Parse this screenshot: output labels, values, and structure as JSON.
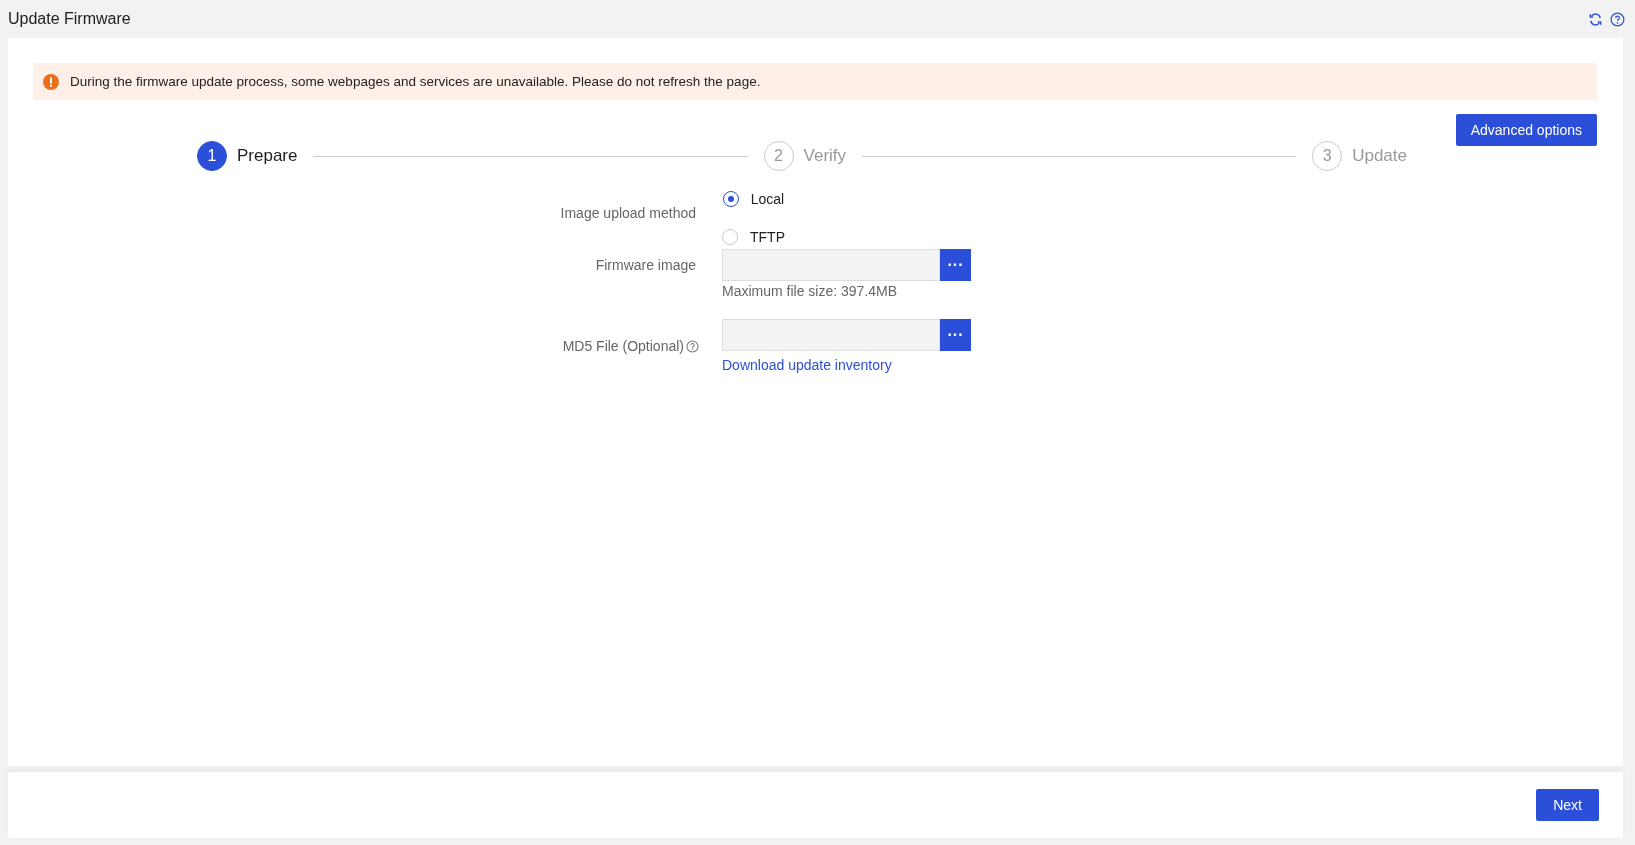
{
  "page": {
    "title": "Update Firmware"
  },
  "alert": {
    "message": "During the firmware update process, some webpages and services are unavailable. Please do not refresh the page."
  },
  "advanced_button": "Advanced options",
  "steps": [
    {
      "number": "1",
      "label": "Prepare",
      "selected": true
    },
    {
      "number": "2",
      "label": "Verify",
      "selected": false
    },
    {
      "number": "3",
      "label": "Update",
      "selected": false
    }
  ],
  "form": {
    "upload_method": {
      "label": "Image upload method",
      "options": [
        {
          "label": "Local",
          "selected": true
        },
        {
          "label": "TFTP",
          "selected": false
        }
      ]
    },
    "firmware_image": {
      "label": "Firmware image",
      "browse": "···",
      "hint": "Maximum file size: 397.4MB"
    },
    "md5_file": {
      "label": "MD5 File (Optional)",
      "browse": "···",
      "link": "Download update inventory"
    }
  },
  "footer": {
    "next_button": "Next"
  }
}
